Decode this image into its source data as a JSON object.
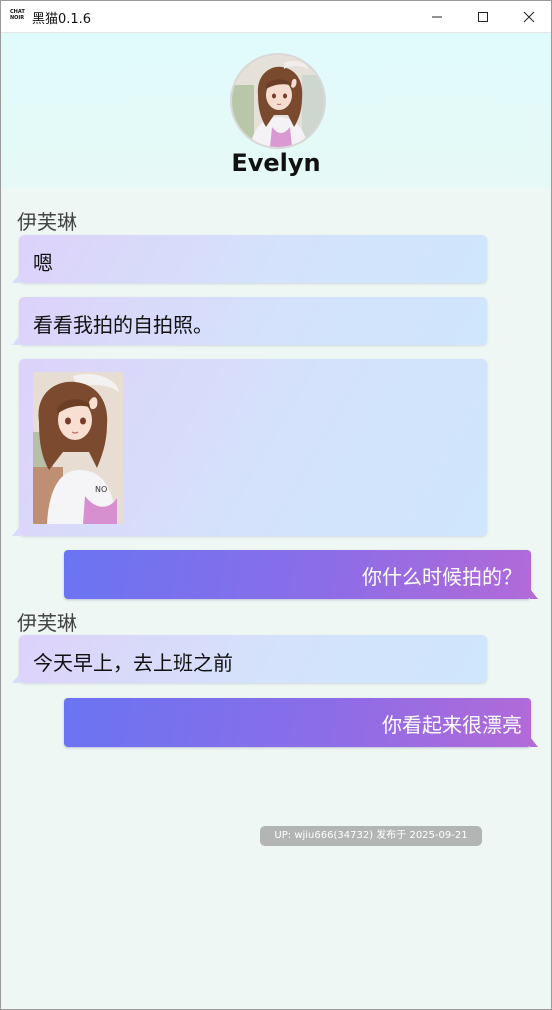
{
  "window": {
    "logo_line1": "CHAT",
    "logo_line2": "NOIR",
    "title": "黑猫0.1.6"
  },
  "profile": {
    "name": "Evelyn"
  },
  "messages": [
    {
      "type": "sender",
      "text": "伊芙琳"
    },
    {
      "type": "incoming",
      "text": "嗯"
    },
    {
      "type": "incoming",
      "text": "看看我拍的自拍照。"
    },
    {
      "type": "incoming-image"
    },
    {
      "type": "outgoing",
      "text": "你什么时候拍的？"
    },
    {
      "type": "sender",
      "text": "伊芙琳"
    },
    {
      "type": "incoming",
      "text": "今天早上，去上班之前"
    },
    {
      "type": "outgoing",
      "text": "你看起来很漂亮"
    }
  ],
  "watermark": "UP: wjiu666(34732) 发布于 2025-09-21",
  "colors": {
    "incoming_bubble": "#d4e2fb",
    "outgoing_bubble": "#8b6de8",
    "header_bg": "#e0fbfb",
    "chat_bg": "#eef7f3"
  }
}
